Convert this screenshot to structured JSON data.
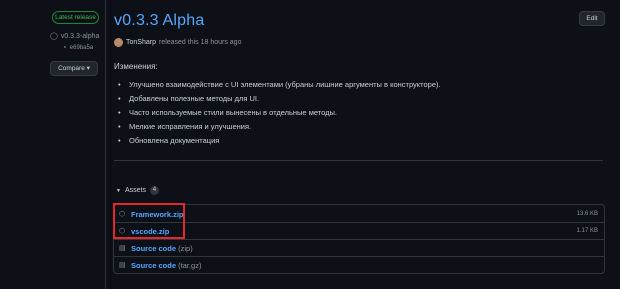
{
  "sidebar": {
    "latest_badge": "Latest release",
    "tag": "v0.3.3-alpha",
    "commit": "e69ba5a",
    "compare_label": "Compare",
    "compare_caret": "▾"
  },
  "release": {
    "title": "v0.3.3 Alpha",
    "author": "TonSharp",
    "released_text": "released this 18 hours ago",
    "edit_label": "Edit"
  },
  "notes": {
    "heading": "Изменения:",
    "items": [
      "Улучшено взаимодействие с UI элементами (убраны лишние аргументы в конструкторе).",
      "Добавлены полезные методы для UI.",
      "Часто используемые стили вынесены в отдельные методы.",
      "Мелкие исправления и улучшения.",
      "Обновлена документация"
    ]
  },
  "assets": {
    "label": "Assets",
    "count": "4",
    "files": [
      {
        "name": "Framework.zip",
        "size": "13.6 KB",
        "icon": "package-icon"
      },
      {
        "name": "vscode.zip",
        "size": "1.17 KB",
        "icon": "package-icon"
      },
      {
        "name": "Source code",
        "ext": "(zip)",
        "icon": "file-zip-icon"
      },
      {
        "name": "Source code",
        "ext": "(tar.gz)",
        "icon": "file-zip-icon"
      }
    ]
  },
  "colors": {
    "background": "#0d1117",
    "link": "#58a6ff",
    "badge_green": "#3fb950",
    "highlight_red": "#e5272b"
  }
}
